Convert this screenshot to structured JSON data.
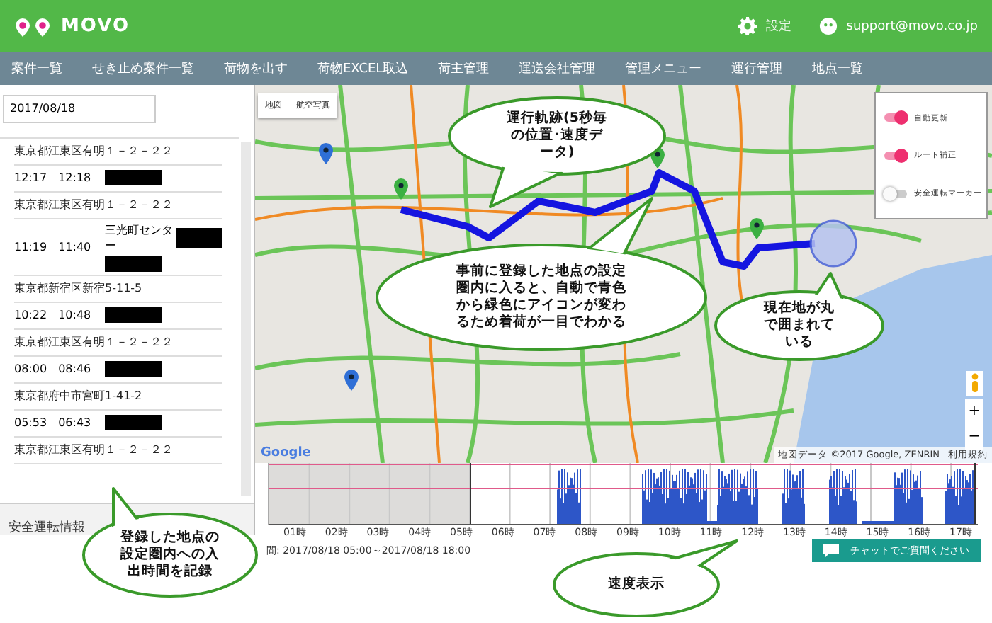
{
  "header": {
    "logo_text": "MOVO",
    "settings_label": "設定",
    "user_email": "support@movo.co.jp"
  },
  "nav": [
    "案件一覧",
    "せき止め案件一覧",
    "荷物を出す",
    "荷物EXCEL取込",
    "荷主管理",
    "運送会社管理",
    "管理メニュー",
    "運行管理",
    "地点一覧"
  ],
  "sidebar": {
    "date": "2017/08/18",
    "entries": [
      {
        "kind": "address",
        "text": "東京都江東区有明１－２－２２"
      },
      {
        "kind": "times",
        "in": "12:17",
        "out": "12:18"
      },
      {
        "kind": "address",
        "text": "東京都江東区有明１－２－２２"
      },
      {
        "kind": "times",
        "in": "11:19",
        "out": "11:40",
        "place": "三光町センター"
      },
      {
        "kind": "address",
        "text": "東京都新宿区新宿5-11-5"
      },
      {
        "kind": "times",
        "in": "10:22",
        "out": "10:48"
      },
      {
        "kind": "address",
        "text": "東京都江東区有明１－２－２２"
      },
      {
        "kind": "times",
        "in": "08:00",
        "out": "08:46"
      },
      {
        "kind": "address",
        "text": "東京都府中市宮町1-41-2"
      },
      {
        "kind": "times",
        "in": "05:53",
        "out": "06:43"
      },
      {
        "kind": "address",
        "text": "東京都江東区有明１－２－２２"
      }
    ],
    "tab_label": "安全運転情報"
  },
  "map": {
    "type_buttons": [
      "地図",
      "航空写真"
    ],
    "legend": [
      {
        "label": "自動更新",
        "on": true
      },
      {
        "label": "ルート補正",
        "on": true
      },
      {
        "label": "安全運転マーカー",
        "on": false
      }
    ],
    "pins": [
      {
        "color": "#2f6fd6"
      },
      {
        "color": "#3cb043"
      },
      {
        "color": "#3cb043"
      },
      {
        "color": "#3cb043"
      },
      {
        "color": "#2f6fd6"
      }
    ],
    "zoom_buttons": [
      "+",
      "−"
    ],
    "google_logo": "Google",
    "attribution": "地図データ ©2017 Google, ZENRIN",
    "terms": "利用規約"
  },
  "speed_chart": {
    "hour_labels": [
      "01時",
      "02時",
      "03時",
      "04時",
      "05時",
      "06時",
      "07時",
      "08時",
      "09時",
      "10時",
      "11時",
      "12時",
      "13時",
      "14時",
      "15時",
      "16時",
      "17時"
    ],
    "period": "間: 2017/08/18 05:00～2017/08/18 18:00"
  },
  "chat_button": "チャットでご質問ください",
  "callouts": [
    "運行軌跡(5秒毎の位置･速度データ)",
    "事前に登録した地点の設定圏内に入ると、自動で青色から緑色にアイコンが変わるため着荷が一目でわかる",
    "現在地が丸で囲まれている",
    "登録した地点の設定圏内への入出時間を記録",
    "速度表示"
  ]
}
